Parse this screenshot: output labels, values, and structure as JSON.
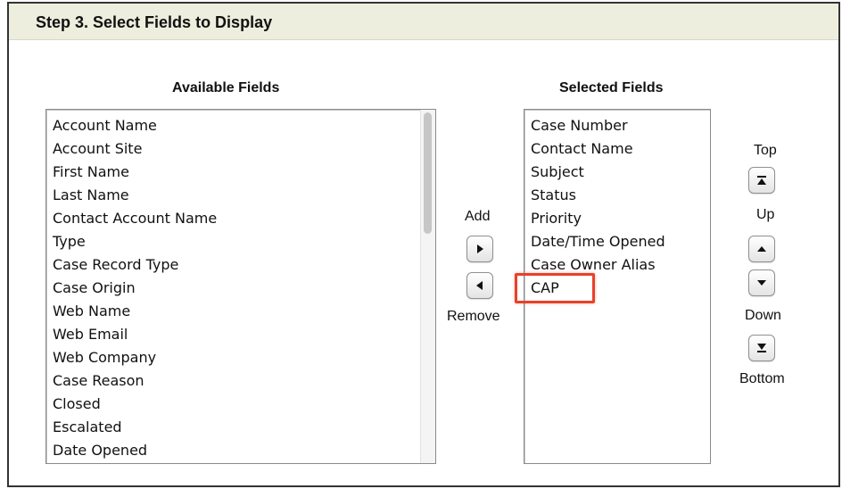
{
  "header": {
    "title": "Step 3. Select Fields to Display"
  },
  "available": {
    "title": "Available Fields",
    "items": [
      "Account Name",
      "Account Site",
      "First Name",
      "Last Name",
      "Contact Account Name",
      "Type",
      "Case Record Type",
      "Case Origin",
      "Web Name",
      "Web Email",
      "Web Company",
      "Case Reason",
      "Closed",
      "Escalated",
      "Date Opened"
    ]
  },
  "selected": {
    "title": "Selected Fields",
    "items": [
      "Case Number",
      "Contact Name",
      "Subject",
      "Status",
      "Priority",
      "Date/Time Opened",
      "Case Owner Alias",
      "CAP"
    ],
    "highlighted_item": "CAP",
    "highlight_color": "#e8412a"
  },
  "add_remove": {
    "add_label": "Add",
    "remove_label": "Remove"
  },
  "ordering": {
    "top_label": "Top",
    "up_label": "Up",
    "down_label": "Down",
    "bottom_label": "Bottom"
  },
  "colors": {
    "header_bg": "#eeeede"
  }
}
